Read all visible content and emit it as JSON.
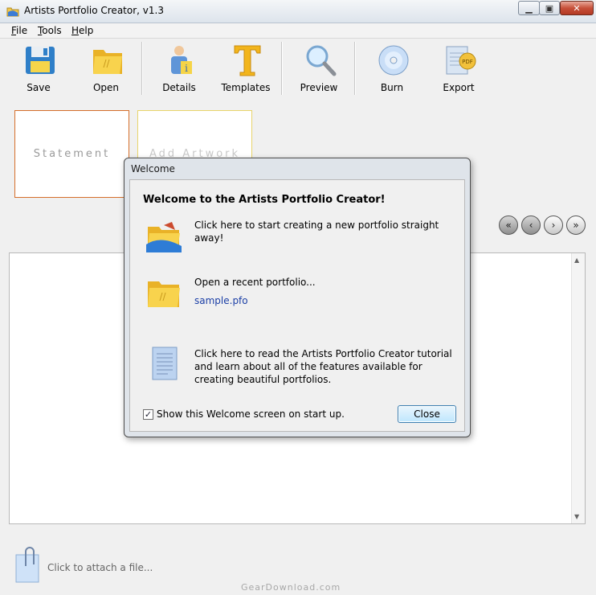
{
  "window": {
    "title": "Artists Portfolio Creator, v1.3"
  },
  "menu": [
    {
      "label": "File",
      "mnemonic": "F",
      "rest": "ile"
    },
    {
      "label": "Tools",
      "mnemonic": "T",
      "rest": "ools"
    },
    {
      "label": "Help",
      "mnemonic": "H",
      "rest": "elp"
    }
  ],
  "toolbar": {
    "save": "Save",
    "open": "Open",
    "details": "Details",
    "templates": "Templates",
    "preview": "Preview",
    "burn": "Burn",
    "export": "Export",
    "export_badge": "PDF"
  },
  "slides": {
    "statement": "Statement",
    "add_artwork": "Add Artwork"
  },
  "nav": {
    "first": "«",
    "prev": "‹",
    "next": "›",
    "last": "»"
  },
  "editor": {
    "scroll_up": "▲",
    "scroll_down": "▼"
  },
  "attach": {
    "text": "Click to attach a file..."
  },
  "watermark": "GearDownload.com",
  "dialog": {
    "title": "Welcome",
    "heading": "Welcome to the Artists Portfolio Creator!",
    "new_portfolio": "Click here to start creating a new portfolio straight away!",
    "open_recent": "Open a recent portfolio...",
    "recent_file": "sample.pfo",
    "tutorial": "Click here to read the Artists Portfolio Creator tutorial and learn about all of the features available for creating beautiful portfolios.",
    "show_on_startup": "Show this Welcome screen on start up.",
    "show_on_startup_checked": true,
    "close": "Close"
  },
  "colors": {
    "statement_border": "#d56f2b",
    "add_artwork_border": "#e8d46a",
    "link": "#1b3fa6",
    "close_button": "#c7503a"
  }
}
